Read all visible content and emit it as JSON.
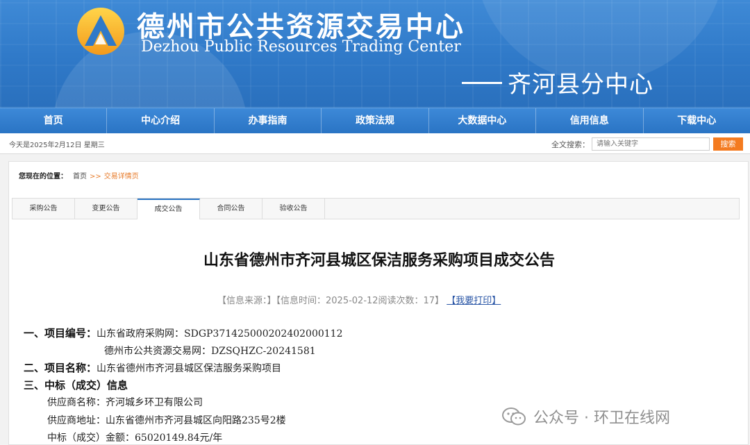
{
  "header": {
    "title": "德州市公共资源交易中心",
    "subtitle": "Dezhou Public Resources Trading Center",
    "branch": "齐河县分中心"
  },
  "nav": [
    "首页",
    "中心介绍",
    "办事指南",
    "政策法规",
    "大数据中心",
    "信用信息",
    "下载中心"
  ],
  "infobar": {
    "date": "今天是2025年2月12日  星期三",
    "search_label": "全文搜索：",
    "search_placeholder": "请输入关键字",
    "search_button": "搜索"
  },
  "breadcrumb": {
    "label": "您现在的位置：",
    "home": "首页",
    "sep": ">>",
    "current": "交易详情页"
  },
  "tabs": [
    {
      "label": "采购公告",
      "active": false
    },
    {
      "label": "变更公告",
      "active": false
    },
    {
      "label": "成交公告",
      "active": true
    },
    {
      "label": "合同公告",
      "active": false
    },
    {
      "label": "验收公告",
      "active": false
    }
  ],
  "doc": {
    "title": "山东省德州市齐河县城区保洁服务采购项目成交公告",
    "meta": "【信息来源：】【信息时间：2025-02-12阅读次数：17】",
    "print": "【我要打印】",
    "sec1_head": "一、项目编号：",
    "sec1_val1": "山东省政府采购网：SDGP371425000202402000112",
    "sec1_val2": "德州市公共资源交易网：DZSQHZC-20241581",
    "sec2_head": "二、项目名称：",
    "sec2_val": "山东省德州市齐河县城区保洁服务采购项目",
    "sec3_head": "三、中标（成交）信息",
    "supplier_name": "供应商名称：齐河城乡环卫有限公司",
    "supplier_addr": "供应商地址：山东省德州市齐河县城区向阳路235号2楼",
    "amount": "中标（成交）金额：65020149.84元/年"
  },
  "watermark": "公众号 · 环卫在线网",
  "colors": {
    "nav_blue": "#2a74c4",
    "accent_orange": "#f47b20",
    "link": "#2a56a6"
  }
}
